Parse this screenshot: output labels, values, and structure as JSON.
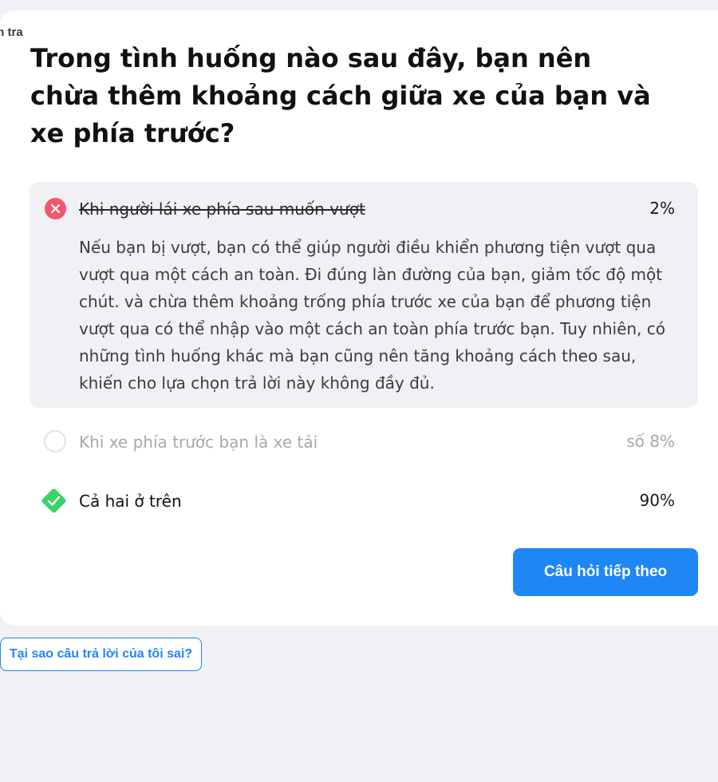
{
  "header": {
    "corner_label": "m tra"
  },
  "question": {
    "text": "Trong tình huống nào sau đây, bạn nên chừa thêm khoảng cách giữa xe của bạn và xe phía trước?"
  },
  "answers": [
    {
      "label": "Khi người lái xe phía sau muốn vượt",
      "percent": "2%",
      "state": "wrong-selected",
      "icon": "x-icon",
      "explanation": "Nếu bạn bị vượt, bạn có thể giúp người điều khiển phương tiện vượt qua vượt qua một cách an toàn. Đi đúng làn đường của bạn, giảm tốc độ một chút. và chừa thêm khoảng trống phía trước xe của bạn để phương tiện vượt qua có thể nhập vào một cách an toàn phía trước bạn. Tuy nhiên, có những tình huống khác mà bạn cũng nên tăng khoảng cách theo sau, khiến cho lựa chọn trả lời này không đầy đủ."
    },
    {
      "label": "Khi xe phía trước bạn là xe tải",
      "percent": "số 8%",
      "state": "unselected",
      "icon": "radio-empty"
    },
    {
      "label": "Cả hai ở trên",
      "percent": "90%",
      "state": "correct",
      "icon": "check-icon"
    }
  ],
  "actions": {
    "next_label": "Câu hỏi tiếp theo",
    "why_label": "Tại sao câu trả lời của tôi sai?"
  },
  "colors": {
    "accent": "#1e86f5",
    "wrong": "#f0586b",
    "correct": "#3ad466",
    "page_background": "#f0f0f5",
    "explanation_background": "#f1f0f5"
  }
}
